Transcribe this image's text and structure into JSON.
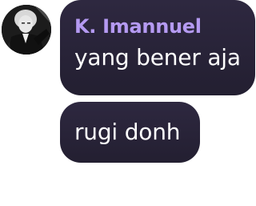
{
  "messages": [
    {
      "sender": "K. Imannuel",
      "text": "yang bener aja"
    },
    {
      "text": "rugi donh"
    }
  ],
  "colors": {
    "sender_name": "#b59af2",
    "bubble": "#2a2538",
    "message_text": "#ffffff"
  },
  "icons": {
    "avatar": "user-profile-photo"
  }
}
